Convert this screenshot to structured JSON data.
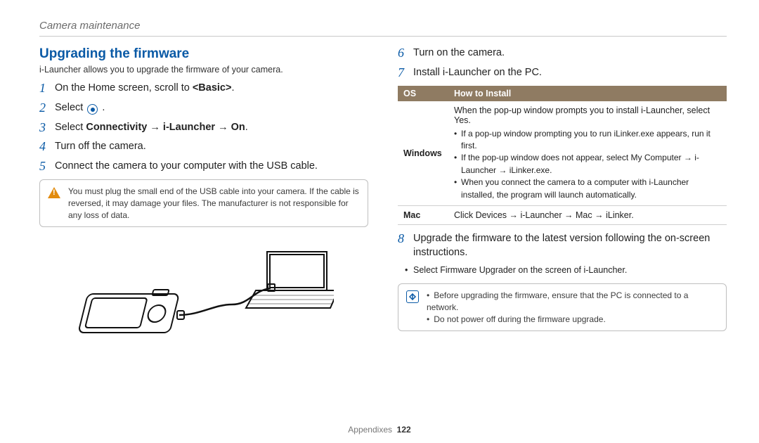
{
  "header": {
    "section": "Camera maintenance"
  },
  "left": {
    "title": "Upgrading the firmware",
    "intro": "i-Launcher allows you to upgrade the firmware of your camera.",
    "step1": {
      "n": "1",
      "pre": "On the Home screen, scroll to ",
      "bold": "<Basic>",
      "post": "."
    },
    "step2": {
      "n": "2",
      "pre": "Select ",
      "iconName": "target-icon",
      "post": " ."
    },
    "step3": {
      "n": "3",
      "pre": "Select ",
      "b1": "Connectivity",
      "arr": " → ",
      "b2": "i-Launcher",
      "b3": "On",
      "post": "."
    },
    "step4": {
      "n": "4",
      "text": "Turn off the camera."
    },
    "step5": {
      "n": "5",
      "text": "Connect the camera to your computer with the USB cable."
    },
    "warn": "You must plug the small end of the USB cable into your camera. If the cable is reversed, it may damage your files. The manufacturer is not responsible for any loss of data."
  },
  "right": {
    "step6": {
      "n": "6",
      "text": "Turn on the camera."
    },
    "step7": {
      "n": "7",
      "text": "Install i-Launcher on the PC."
    },
    "tbl": {
      "h1": "OS",
      "h2": "How to Install",
      "win": {
        "os": "Windows",
        "lead_a": "When the pop-up window prompts you to install i-Launcher, select ",
        "lead_b": "Yes",
        "lead_c": ".",
        "li1": "If a pop-up window prompting you to run iLinker.exe appears, run it first.",
        "li2_a": "If the pop-up window does not appear, select ",
        "li2_b": "My Computer",
        "li2_arr": " → ",
        "li2_c": "i-Launcher",
        "li2_d": "iLinker.exe",
        "li2_e": ".",
        "li3": "When you connect the camera to a computer with i-Launcher installed, the program will launch automatically."
      },
      "mac": {
        "os": "Mac",
        "a": "Click ",
        "b": "Devices",
        "arr": " → ",
        "c": "i-Launcher",
        "d": "Mac",
        "e": "iLinker",
        "f": "."
      }
    },
    "step8": {
      "n": "8",
      "text": "Upgrade the firmware to the latest version following the on-screen instructions."
    },
    "sub8_a": "Select ",
    "sub8_b": "Firmware Upgrader",
    "sub8_c": " on the screen of i-Launcher.",
    "info": {
      "li1": "Before upgrading the firmware, ensure that the PC is connected to a network.",
      "li2": "Do not power off during the firmware upgrade."
    }
  },
  "footer": {
    "label": "Appendixes",
    "page": "122"
  }
}
